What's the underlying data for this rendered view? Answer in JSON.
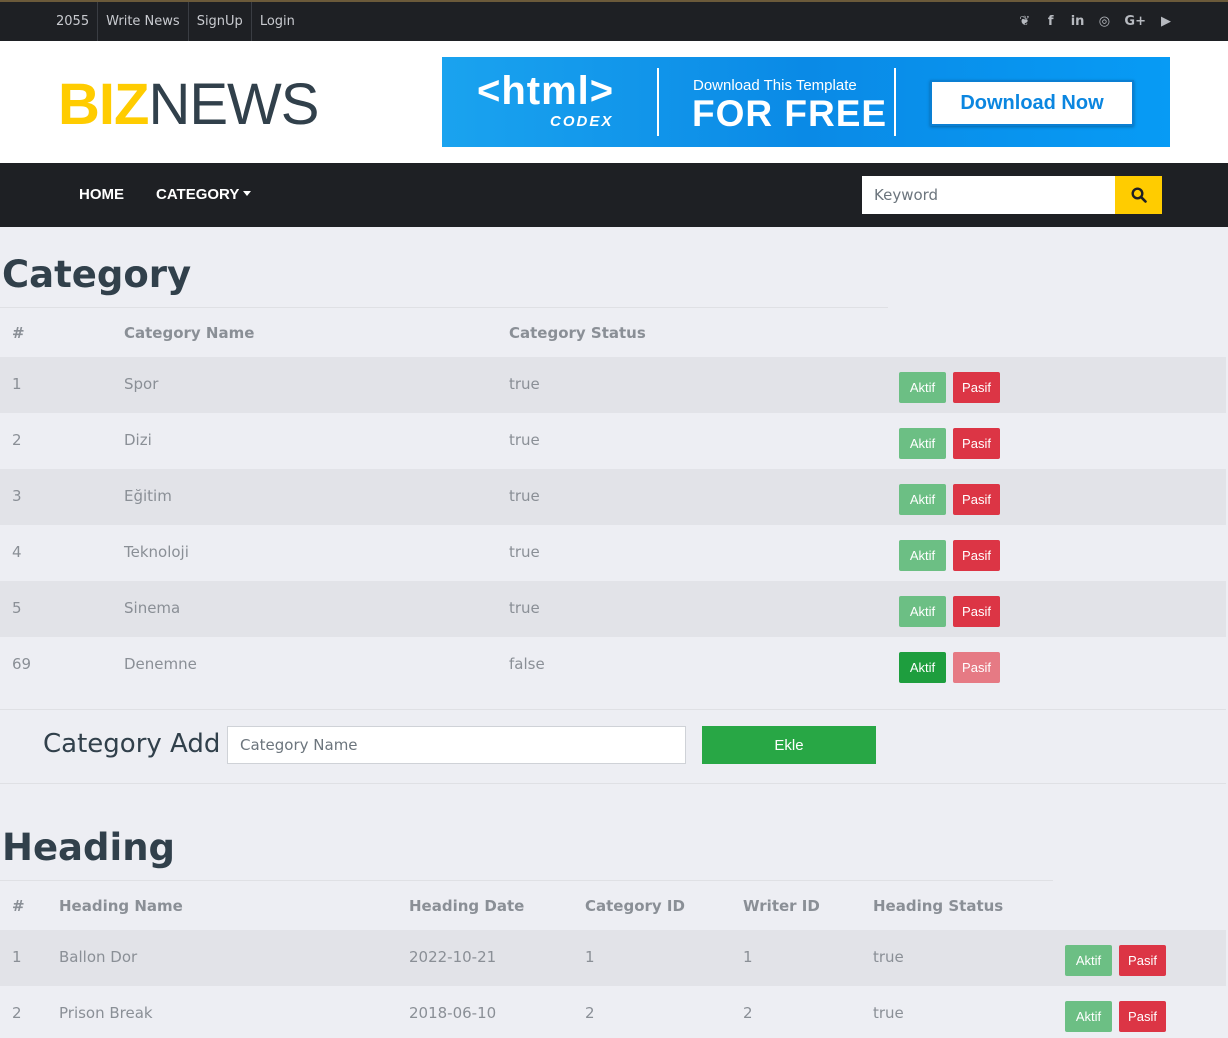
{
  "topbar": {
    "links": [
      "2055",
      "Write News",
      "SignUp",
      "Login"
    ],
    "social_icons": [
      "twitter-icon",
      "facebook-icon",
      "linkedin-icon",
      "instagram-icon",
      "google-plus-icon",
      "youtube-icon"
    ],
    "social_glyphs": [
      "❦",
      "f",
      "in",
      "◎",
      "G+",
      "▶"
    ]
  },
  "brand": {
    "logo_part1": "BIZ",
    "logo_part2": "NEWS",
    "ad": {
      "html": "<html>",
      "codex": "CODEX",
      "small": "Download This Template",
      "big": "FOR FREE",
      "button": "Download Now"
    }
  },
  "nav": {
    "home": "HOME",
    "category": "CATEGORY",
    "search_placeholder": "Keyword"
  },
  "category": {
    "title": "Category",
    "headers": [
      "#",
      "Category Name",
      "Category Status"
    ],
    "rows": [
      {
        "id": "1",
        "name": "Spor",
        "status": "true"
      },
      {
        "id": "2",
        "name": "Dizi",
        "status": "true"
      },
      {
        "id": "3",
        "name": "Eğitim",
        "status": "true"
      },
      {
        "id": "4",
        "name": "Teknoloji",
        "status": "true"
      },
      {
        "id": "5",
        "name": "Sinema",
        "status": "true"
      },
      {
        "id": "69",
        "name": "Denemne",
        "status": "false"
      }
    ],
    "aktif_label": "Aktif",
    "pasif_label": "Pasif"
  },
  "category_add": {
    "label": "Category Add",
    "placeholder": "Category Name",
    "button": "Ekle"
  },
  "heading": {
    "title": "Heading",
    "headers": [
      "#",
      "Heading Name",
      "Heading Date",
      "Category ID",
      "Writer ID",
      "Heading Status"
    ],
    "rows": [
      {
        "id": "1",
        "name": "Ballon Dor",
        "date": "2022-10-21",
        "category_id": "1",
        "writer_id": "1",
        "status": "true"
      },
      {
        "id": "2",
        "name": "Prison Break",
        "date": "2018-06-10",
        "category_id": "2",
        "writer_id": "2",
        "status": "true"
      }
    ],
    "aktif_label": "Aktif",
    "pasif_label": "Pasif"
  },
  "colors": {
    "accent": "#ffcc00",
    "dark": "#1e2024",
    "aktif": "#6cbf84",
    "pasif": "#dc3545",
    "ekle": "#28a745"
  }
}
